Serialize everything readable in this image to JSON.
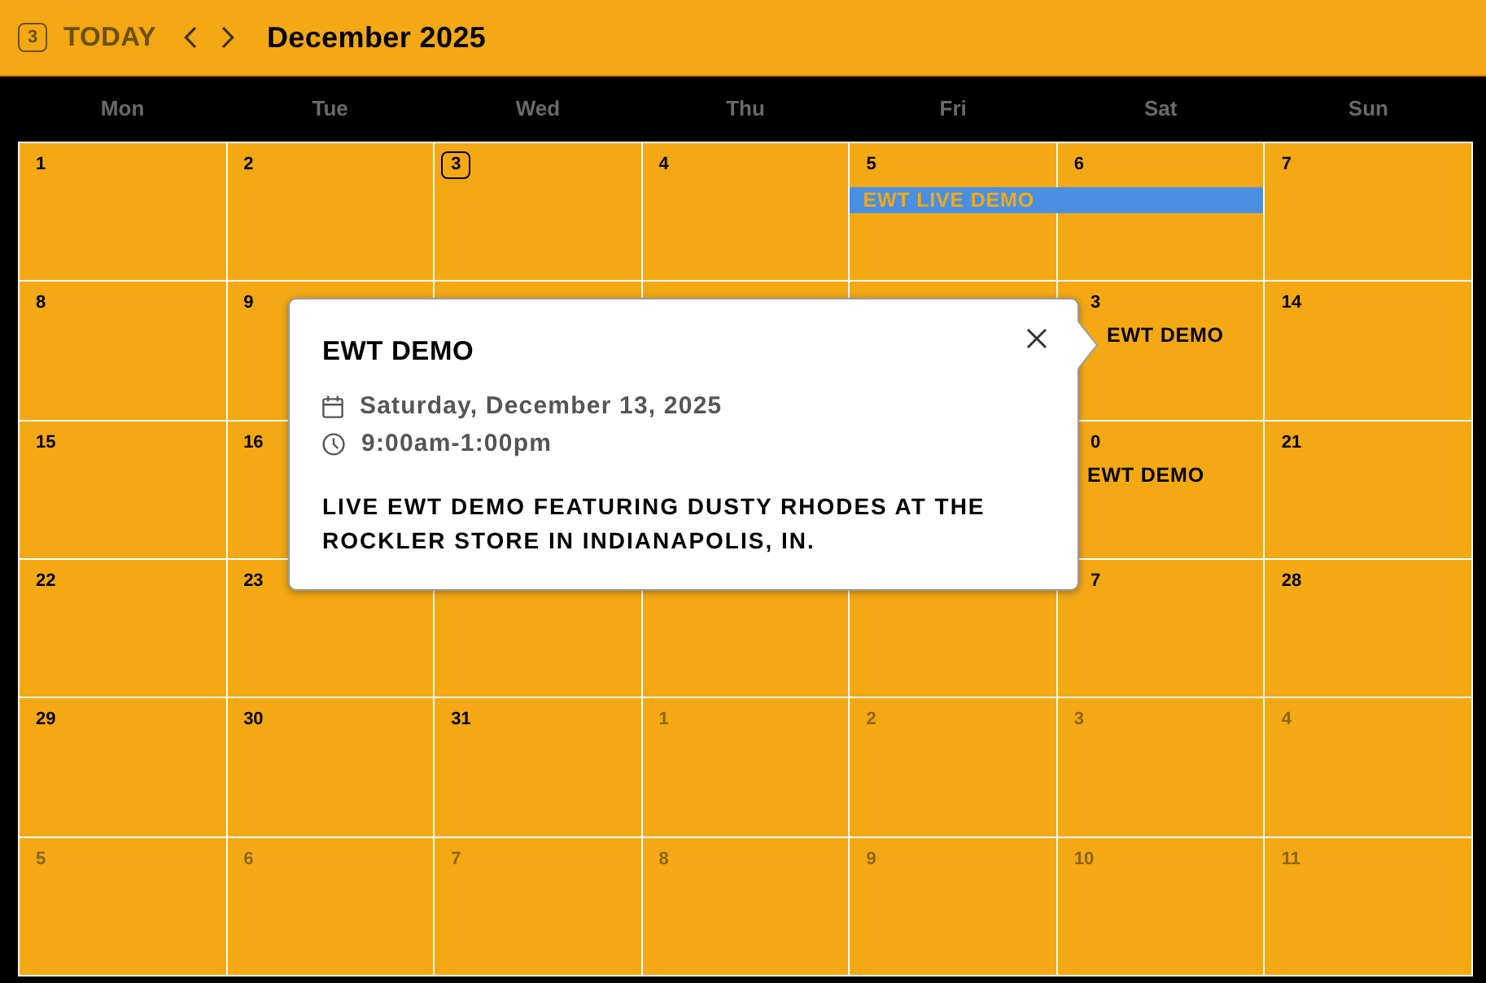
{
  "toolbar": {
    "date_badge": "3",
    "today_button": "TODAY",
    "title": "December 2025"
  },
  "weekdays": [
    "Mon",
    "Tue",
    "Wed",
    "Thu",
    "Fri",
    "Sat",
    "Sun"
  ],
  "weeks": [
    {
      "mon": {
        "day": "1",
        "other_month": false,
        "today": false
      },
      "tue": {
        "day": "2",
        "other_month": false,
        "today": false
      },
      "wed": {
        "day": "3",
        "other_month": false,
        "today": true
      },
      "thu": {
        "day": "4",
        "other_month": false,
        "today": false
      },
      "fri": {
        "day": "5",
        "other_month": false,
        "today": false,
        "events": [
          {
            "title": "EWT LIVE DEMO",
            "kind": "bar",
            "continues": true
          }
        ]
      },
      "sat": {
        "day": "6",
        "other_month": false,
        "today": false
      },
      "sun": {
        "day": "7",
        "other_month": false,
        "today": false
      }
    },
    {
      "mon": {
        "day": "8",
        "other_month": false,
        "today": false
      },
      "tue": {
        "day": "9",
        "other_month": false,
        "today": false
      },
      "sat": {
        "day": "3",
        "other_month": false,
        "today": false,
        "events": [
          {
            "title": "EWT DEMO",
            "kind": "text"
          }
        ]
      },
      "sun": {
        "day": "14",
        "other_month": false,
        "today": false
      }
    },
    {
      "mon": {
        "day": "15",
        "other_month": false,
        "today": false
      },
      "tue": {
        "day": "16",
        "other_month": false,
        "today": false
      },
      "sat": {
        "day": "0",
        "other_month": false,
        "today": false,
        "events": [
          {
            "title": "EWT DEMO",
            "kind": "text"
          }
        ]
      },
      "sun": {
        "day": "21",
        "other_month": false,
        "today": false
      }
    },
    {
      "mon": {
        "day": "22",
        "other_month": false,
        "today": false
      },
      "tue": {
        "day": "23",
        "other_month": false,
        "today": false
      },
      "sat": {
        "day": "7",
        "other_month": false,
        "today": false
      },
      "sun": {
        "day": "28",
        "other_month": false,
        "today": false
      }
    },
    {
      "mon": {
        "day": "29",
        "other_month": false,
        "today": false
      },
      "tue": {
        "day": "30",
        "other_month": false,
        "today": false
      },
      "wed": {
        "day": "31",
        "other_month": false,
        "today": false
      },
      "thu": {
        "day": "1",
        "other_month": true,
        "today": false
      },
      "fri": {
        "day": "2",
        "other_month": true,
        "today": false
      },
      "sat": {
        "day": "3",
        "other_month": true,
        "today": false
      },
      "sun": {
        "day": "4",
        "other_month": true,
        "today": false
      }
    },
    {
      "mon": {
        "day": "5",
        "other_month": true,
        "today": false
      },
      "tue": {
        "day": "6",
        "other_month": true,
        "today": false
      },
      "wed": {
        "day": "7",
        "other_month": true,
        "today": false
      },
      "thu": {
        "day": "8",
        "other_month": true,
        "today": false
      },
      "fri": {
        "day": "9",
        "other_month": true,
        "today": false
      },
      "sat": {
        "day": "10",
        "other_month": true,
        "today": false
      },
      "sun": {
        "day": "11",
        "other_month": true,
        "today": false
      }
    }
  ],
  "popover": {
    "title": "EWT DEMO",
    "date": "Saturday, December 13, 2025",
    "time": "9:00am-1:00pm",
    "description": "LIVE EWT DEMO FEATURING DUSTY RHODES AT THE ROCKLER STORE IN INDIANAPOLIS, IN."
  }
}
